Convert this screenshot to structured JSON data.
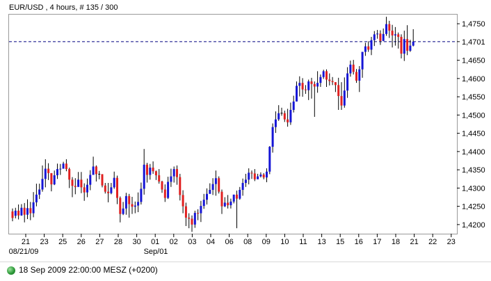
{
  "header": {
    "title": "EUR/USD , 4 hours, # 135 / 300"
  },
  "status": {
    "text": "18 Sep 2009 22:00:00  MESZ (+0200)"
  },
  "colors": {
    "up": "#1515d6",
    "down": "#e02020",
    "wick": "#000000",
    "price_line": "#000080",
    "frame": "#999999"
  },
  "chart_data": {
    "type": "candlestick",
    "symbol": "EUR/USD",
    "timeframe": "4 hours",
    "y_range": [
      1.4175,
      1.4775
    ],
    "y_ticks": [
      1.42,
      1.425,
      1.43,
      1.435,
      1.44,
      1.445,
      1.45,
      1.455,
      1.46,
      1.465,
      1.4701,
      1.475
    ],
    "y_tick_labels": [
      "1,4200",
      "1,4250",
      "1,4300",
      "1,4350",
      "1,4400",
      "1,4450",
      "1,4500",
      "1,4550",
      "1,4600",
      "1,4650",
      "1,4701",
      "1,4750"
    ],
    "current_price": 1.4701,
    "current_price_label": "1,4701",
    "x_tick_labels": [
      "21",
      "23",
      "25",
      "26",
      "27",
      "28",
      "30",
      "01",
      "02",
      "03",
      "04",
      "06",
      "08",
      "09",
      "10",
      "11",
      "13",
      "15",
      "16",
      "17",
      "18",
      "21",
      "22",
      "23"
    ],
    "x_sublabels": [
      "08/21/09",
      "Sep/01"
    ],
    "candles": [
      [
        1.4236,
        1.4218,
        1.4244,
        1.4209
      ],
      [
        1.4224,
        1.4238,
        1.4246,
        1.4217
      ],
      [
        1.4238,
        1.4225,
        1.4255,
        1.4214
      ],
      [
        1.4225,
        1.4246,
        1.4256,
        1.4224
      ],
      [
        1.4246,
        1.4227,
        1.4259,
        1.4206
      ],
      [
        1.4227,
        1.4245,
        1.4269,
        1.4215
      ],
      [
        1.4245,
        1.4231,
        1.4262,
        1.4212
      ],
      [
        1.4231,
        1.4261,
        1.4289,
        1.422
      ],
      [
        1.4261,
        1.4282,
        1.4312,
        1.425
      ],
      [
        1.4282,
        1.4296,
        1.4312,
        1.427
      ],
      [
        1.4296,
        1.4325,
        1.4362,
        1.429
      ],
      [
        1.4325,
        1.4353,
        1.4379,
        1.4302
      ],
      [
        1.4353,
        1.4341,
        1.4368,
        1.4322
      ],
      [
        1.4341,
        1.431,
        1.433,
        1.4291
      ],
      [
        1.431,
        1.4335,
        1.4348,
        1.4308
      ],
      [
        1.4335,
        1.4352,
        1.4367,
        1.4325
      ],
      [
        1.4352,
        1.4353,
        1.4366,
        1.4336
      ],
      [
        1.4353,
        1.4367,
        1.4372,
        1.4353
      ],
      [
        1.4367,
        1.4352,
        1.4379,
        1.4346
      ],
      [
        1.4352,
        1.4323,
        1.4356,
        1.43
      ],
      [
        1.4323,
        1.4306,
        1.433,
        1.4275
      ],
      [
        1.4306,
        1.4303,
        1.4327,
        1.4283
      ],
      [
        1.4303,
        1.4323,
        1.4344,
        1.4306
      ],
      [
        1.4323,
        1.4302,
        1.4344,
        1.4286
      ],
      [
        1.4302,
        1.4288,
        1.4313,
        1.4265
      ],
      [
        1.4288,
        1.4309,
        1.4326,
        1.4275
      ],
      [
        1.4309,
        1.4336,
        1.4349,
        1.4294
      ],
      [
        1.4336,
        1.4359,
        1.4386,
        1.4345
      ],
      [
        1.4359,
        1.4338,
        1.4362,
        1.4318
      ],
      [
        1.4338,
        1.4338,
        1.4347,
        1.4324
      ],
      [
        1.4338,
        1.4307,
        1.4338,
        1.4302
      ],
      [
        1.4307,
        1.429,
        1.4314,
        1.4285
      ],
      [
        1.429,
        1.4286,
        1.4314,
        1.4261
      ],
      [
        1.4286,
        1.4302,
        1.4314,
        1.4283
      ],
      [
        1.4302,
        1.4328,
        1.4345,
        1.4298
      ],
      [
        1.4328,
        1.4273,
        1.4334,
        1.4256
      ],
      [
        1.4273,
        1.4229,
        1.4277,
        1.4206
      ],
      [
        1.4229,
        1.4244,
        1.4262,
        1.4226
      ],
      [
        1.4244,
        1.4278,
        1.4287,
        1.4227
      ],
      [
        1.4278,
        1.4256,
        1.4284,
        1.4219
      ],
      [
        1.4256,
        1.4249,
        1.4276,
        1.4229
      ],
      [
        1.4249,
        1.4252,
        1.4263,
        1.4231
      ],
      [
        1.4252,
        1.4262,
        1.4288,
        1.4234
      ],
      [
        1.4262,
        1.4298,
        1.4315,
        1.4255
      ],
      [
        1.4298,
        1.4364,
        1.4407,
        1.4282
      ],
      [
        1.4364,
        1.4336,
        1.4369,
        1.4315
      ],
      [
        1.4336,
        1.4356,
        1.4366,
        1.4323
      ],
      [
        1.4356,
        1.4346,
        1.4373,
        1.4339
      ],
      [
        1.4346,
        1.4335,
        1.4348,
        1.4322
      ],
      [
        1.4335,
        1.4318,
        1.4352,
        1.4312
      ],
      [
        1.4318,
        1.4296,
        1.432,
        1.4287
      ],
      [
        1.4296,
        1.4273,
        1.431,
        1.4262
      ],
      [
        1.4273,
        1.4317,
        1.4331,
        1.427
      ],
      [
        1.4317,
        1.4332,
        1.4353,
        1.4303
      ],
      [
        1.4332,
        1.4352,
        1.4359,
        1.4315
      ],
      [
        1.4352,
        1.433,
        1.4362,
        1.4309
      ],
      [
        1.433,
        1.4281,
        1.4339,
        1.4266
      ],
      [
        1.4281,
        1.425,
        1.4294,
        1.4231
      ],
      [
        1.425,
        1.4219,
        1.426,
        1.4196
      ],
      [
        1.4219,
        1.4216,
        1.4231,
        1.419
      ],
      [
        1.4216,
        1.42,
        1.4225,
        1.418
      ],
      [
        1.42,
        1.4232,
        1.4238,
        1.4191
      ],
      [
        1.4232,
        1.4231,
        1.4242,
        1.4212
      ],
      [
        1.4231,
        1.4251,
        1.4265,
        1.4207
      ],
      [
        1.4251,
        1.4268,
        1.4284,
        1.4243
      ],
      [
        1.4268,
        1.4284,
        1.4299,
        1.4255
      ],
      [
        1.4284,
        1.4295,
        1.4313,
        1.4287
      ],
      [
        1.4295,
        1.4311,
        1.4327,
        1.4281
      ],
      [
        1.4311,
        1.4327,
        1.4348,
        1.4279
      ],
      [
        1.4327,
        1.429,
        1.4332,
        1.4285
      ],
      [
        1.429,
        1.425,
        1.4296,
        1.4229
      ],
      [
        1.425,
        1.426,
        1.4275,
        1.4248
      ],
      [
        1.426,
        1.4253,
        1.4281,
        1.4244
      ],
      [
        1.4253,
        1.4263,
        1.4271,
        1.4244
      ],
      [
        1.4263,
        1.4282,
        1.4282,
        1.4258
      ],
      [
        1.4282,
        1.4271,
        1.4293,
        1.419
      ],
      [
        1.4271,
        1.4295,
        1.4303,
        1.4268
      ],
      [
        1.4295,
        1.4314,
        1.4326,
        1.4279
      ],
      [
        1.4314,
        1.4323,
        1.4339,
        1.4303
      ],
      [
        1.4323,
        1.4342,
        1.4354,
        1.431
      ],
      [
        1.4342,
        1.434,
        1.4348,
        1.4325
      ],
      [
        1.434,
        1.4324,
        1.4352,
        1.4319
      ],
      [
        1.4324,
        1.4332,
        1.4339,
        1.4328
      ],
      [
        1.4332,
        1.4337,
        1.4343,
        1.4329
      ],
      [
        1.4337,
        1.4329,
        1.4341,
        1.4324
      ],
      [
        1.4329,
        1.4345,
        1.4354,
        1.4316
      ],
      [
        1.4345,
        1.4413,
        1.4415,
        1.4338
      ],
      [
        1.4413,
        1.4467,
        1.4477,
        1.4397
      ],
      [
        1.4467,
        1.4488,
        1.451,
        1.4451
      ],
      [
        1.4488,
        1.4505,
        1.4527,
        1.4484
      ],
      [
        1.4505,
        1.4505,
        1.452,
        1.4498
      ],
      [
        1.4505,
        1.4488,
        1.4512,
        1.4481
      ],
      [
        1.4488,
        1.448,
        1.4517,
        1.4468
      ],
      [
        1.448,
        1.4514,
        1.4534,
        1.4473
      ],
      [
        1.4514,
        1.4537,
        1.4553,
        1.4507
      ],
      [
        1.4537,
        1.458,
        1.4592,
        1.4537
      ],
      [
        1.458,
        1.4588,
        1.4606,
        1.4551
      ],
      [
        1.4588,
        1.457,
        1.4601,
        1.455
      ],
      [
        1.457,
        1.4568,
        1.4582,
        1.4558
      ],
      [
        1.4568,
        1.4592,
        1.4597,
        1.4541
      ],
      [
        1.4592,
        1.4585,
        1.4602,
        1.4545
      ],
      [
        1.4585,
        1.4578,
        1.4592,
        1.4495
      ],
      [
        1.4578,
        1.4588,
        1.462,
        1.4561
      ],
      [
        1.4588,
        1.4604,
        1.4611,
        1.4577
      ],
      [
        1.4604,
        1.462,
        1.4624,
        1.4599
      ],
      [
        1.462,
        1.4597,
        1.4625,
        1.4577
      ],
      [
        1.4597,
        1.4593,
        1.4614,
        1.4581
      ],
      [
        1.4593,
        1.459,
        1.4604,
        1.4582
      ],
      [
        1.459,
        1.4582,
        1.459,
        1.4563
      ],
      [
        1.4582,
        1.4552,
        1.4602,
        1.4514
      ],
      [
        1.4552,
        1.4526,
        1.459,
        1.4514
      ],
      [
        1.4526,
        1.4567,
        1.4603,
        1.452
      ],
      [
        1.4567,
        1.4614,
        1.4631,
        1.4547
      ],
      [
        1.4614,
        1.4638,
        1.4649,
        1.4605
      ],
      [
        1.4638,
        1.4618,
        1.4651,
        1.4611
      ],
      [
        1.4618,
        1.4594,
        1.4626,
        1.4588
      ],
      [
        1.4594,
        1.4625,
        1.4634,
        1.4563
      ],
      [
        1.4625,
        1.4673,
        1.4673,
        1.4602
      ],
      [
        1.4673,
        1.4688,
        1.4698,
        1.4662
      ],
      [
        1.4688,
        1.4679,
        1.4702,
        1.4673
      ],
      [
        1.4679,
        1.4705,
        1.4714,
        1.4664
      ],
      [
        1.4705,
        1.4721,
        1.473,
        1.4689
      ],
      [
        1.4721,
        1.4723,
        1.4733,
        1.4709
      ],
      [
        1.4723,
        1.4703,
        1.4732,
        1.4692
      ],
      [
        1.4703,
        1.4722,
        1.4737,
        1.4702
      ],
      [
        1.4722,
        1.4749,
        1.4769,
        1.4717
      ],
      [
        1.4749,
        1.4731,
        1.4758,
        1.4711
      ],
      [
        1.4731,
        1.4718,
        1.4747,
        1.4685
      ],
      [
        1.4718,
        1.4721,
        1.4741,
        1.469
      ],
      [
        1.4721,
        1.4714,
        1.4726,
        1.4682
      ],
      [
        1.4714,
        1.4668,
        1.4721,
        1.4655
      ],
      [
        1.4668,
        1.4708,
        1.4731,
        1.4648
      ],
      [
        1.4708,
        1.4676,
        1.4746,
        1.4664
      ],
      [
        1.4676,
        1.469,
        1.4706,
        1.4673
      ],
      [
        1.469,
        1.4701,
        1.4735,
        1.4688
      ]
    ]
  }
}
